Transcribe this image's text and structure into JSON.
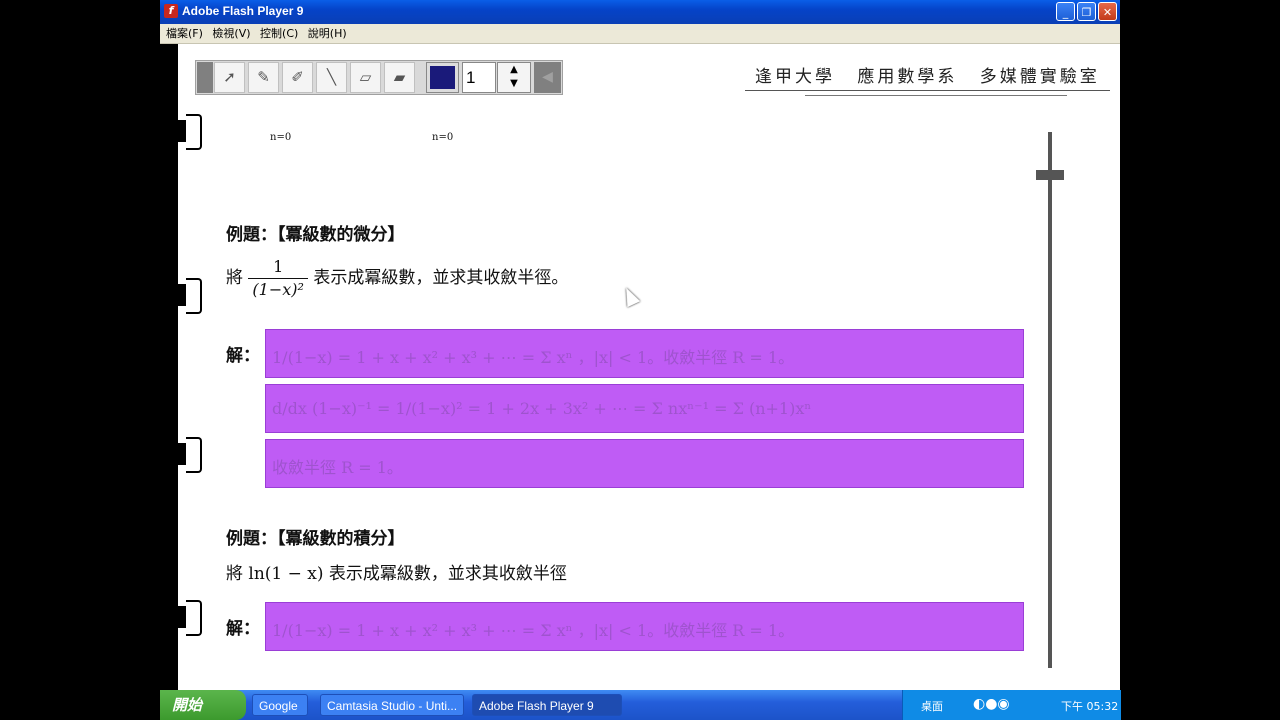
{
  "window": {
    "title": "Adobe Flash Player 9"
  },
  "menu": [
    "檔案(F)",
    "檢視(V)",
    "控制(C)",
    "說明(H)"
  ],
  "toolbar": {
    "stroke_value": "1",
    "color": "#1a1a7a"
  },
  "header": {
    "institution": "逢甲大學 應用數學系 多媒體實驗室"
  },
  "fragment": {
    "label1": "n=0",
    "label2": "n=0"
  },
  "example1": {
    "title": "例題：【冪級數的微分】",
    "prompt_prefix": "將",
    "frac_num": "1",
    "frac_den": "(1−x)²",
    "prompt_suffix": "表示成冪級數，並求其收斂半徑。",
    "solution_label": "解：",
    "line1": "1/(1−x) = 1 + x + x² + x³ + ⋯ = Σ xⁿ ，|x| < 1。收斂半徑 R = 1。",
    "line2": "d/dx (1−x)⁻¹ = 1/(1−x)² = 1 + 2x + 3x² + ⋯ = Σ nxⁿ⁻¹ = Σ (n+1)xⁿ",
    "line3": "收斂半徑 R = 1。"
  },
  "example2": {
    "title": "例題：【冪級數的積分】",
    "prompt": "將 ln(1 − x) 表示成冪級數，並求其收斂半徑",
    "solution_label": "解：",
    "line1": "1/(1−x) = 1 + x + x² + x³ + ⋯ = Σ xⁿ ，|x| < 1。收斂半徑 R = 1。"
  },
  "taskbar": {
    "start": "開始",
    "items": [
      "Google",
      "Camtasia Studio - Unti...",
      "Adobe Flash Player 9"
    ],
    "tray_label": "桌面",
    "clock": "下午 05:32"
  }
}
